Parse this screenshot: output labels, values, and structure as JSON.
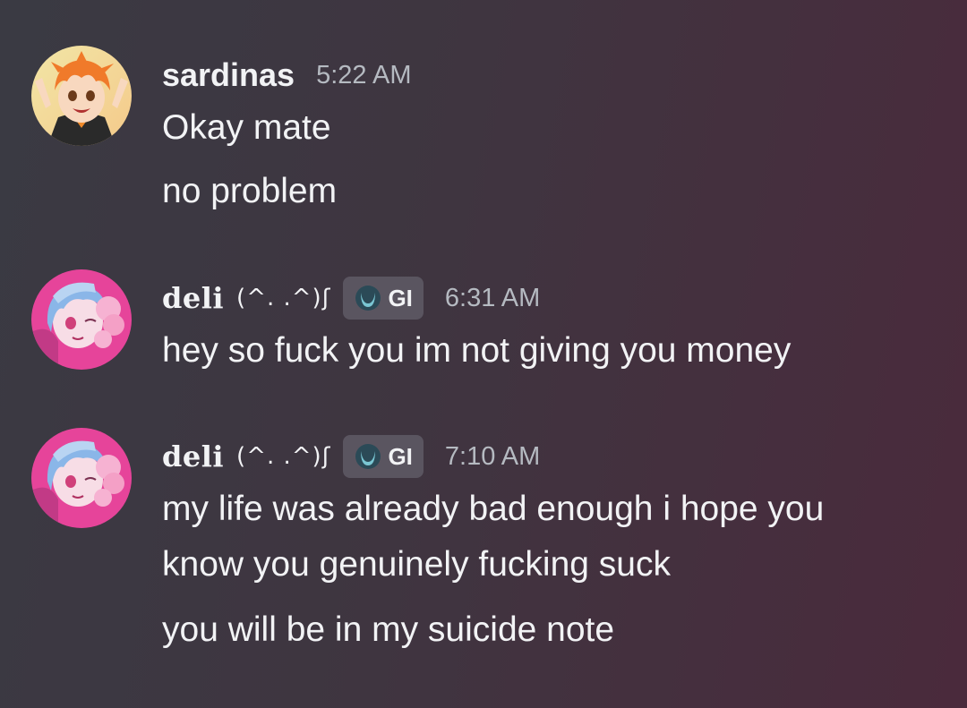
{
  "messages": [
    {
      "username": "sardinas",
      "timestamp": "5:22 AM",
      "lines": [
        "Okay mate",
        "no problem"
      ]
    },
    {
      "username": "deli",
      "kaomoji": "(^. .^)ʃ",
      "tag": "GI",
      "timestamp": "6:31 AM",
      "lines": [
        "hey so fuck you im not giving you money"
      ]
    },
    {
      "username": "deli",
      "kaomoji": "(^. .^)ʃ",
      "tag": "GI",
      "timestamp": "7:10 AM",
      "lines": [
        "my life was already bad enough i hope you",
        "know you genuinely fucking suck",
        "you will be in my suicide note"
      ]
    }
  ],
  "colors": {
    "text": "#f2f3f5",
    "timestamp": "#b5bac1",
    "tag_bg": "#5a5560",
    "tag_icon": "#7ac6d3"
  },
  "icons": {
    "avatar_1": "anime-avatar-orange-hair",
    "avatar_2": "anime-avatar-blue-pink-hair",
    "tag_icon": "crescent-badge-icon"
  }
}
